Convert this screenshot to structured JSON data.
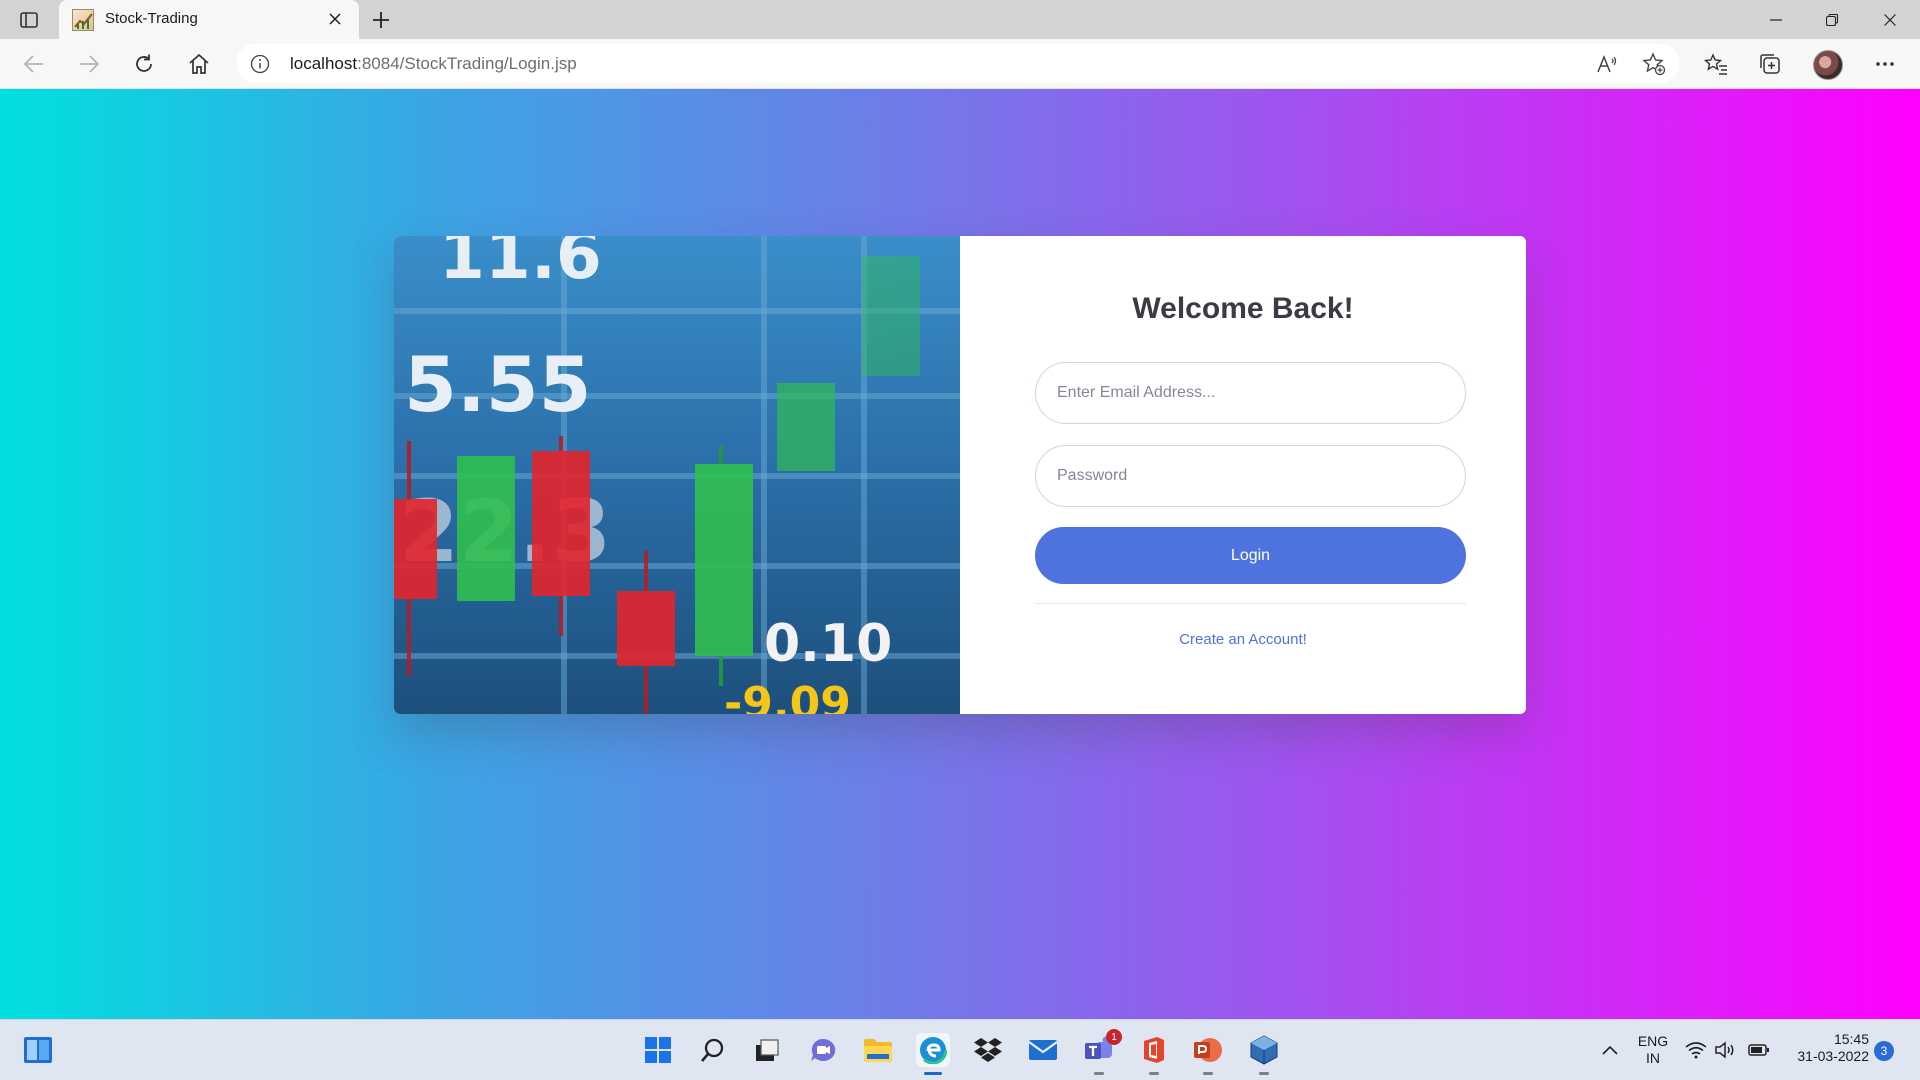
{
  "browser": {
    "tab_title": "Stock-Trading",
    "url_host": "localhost",
    "url_rest": ":8084/StockTrading/Login.jsp"
  },
  "login_card": {
    "heading": "Welcome Back!",
    "email_placeholder": "Enter Email Address...",
    "password_placeholder": "Password",
    "login_label": "Login",
    "create_account_label": "Create an Account!",
    "image_texts": [
      "11.6",
      "5.55",
      "22.3",
      "0.10",
      "-9.09"
    ]
  },
  "taskbar": {
    "teams_badge": "1",
    "language": "ENG",
    "region": "IN",
    "time": "15:45",
    "date": "31-03-2022",
    "notification_count": "3"
  },
  "colors": {
    "gradient_start": "#00e0df",
    "gradient_end": "#ff00ff",
    "primary": "#4e73df",
    "heading": "#3a3b45"
  }
}
